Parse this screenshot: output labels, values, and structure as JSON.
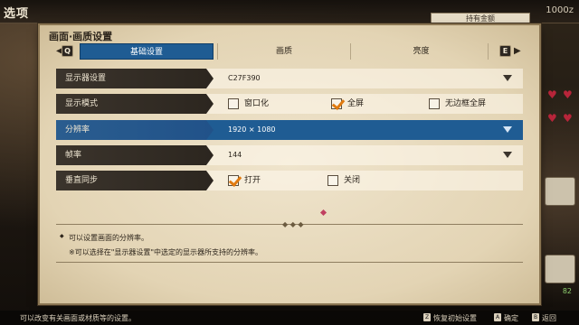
{
  "screen_title": "选项",
  "background": {
    "counter": "1000z",
    "tab_text": "持有金额"
  },
  "panel": {
    "title": "画面·画质设置",
    "tabs": {
      "left_key": "Q",
      "right_key": "E",
      "items": [
        {
          "label": "基础设置",
          "active": true
        },
        {
          "label": "画质",
          "active": false
        },
        {
          "label": "亮度",
          "active": false
        }
      ]
    },
    "rows": [
      {
        "label": "显示器设置",
        "type": "dropdown",
        "value": "C27F390"
      },
      {
        "label": "显示模式",
        "type": "radio",
        "options": [
          {
            "label": "窗口化",
            "checked": false
          },
          {
            "label": "全屏",
            "checked": true
          },
          {
            "label": "无边框全屏",
            "checked": false
          }
        ]
      },
      {
        "label": "分辨率",
        "type": "dropdown",
        "value": "1920 × 1080",
        "selected": true
      },
      {
        "label": "帧率",
        "type": "dropdown",
        "value": "144"
      },
      {
        "label": "垂直同步",
        "type": "radio",
        "options": [
          {
            "label": "打开",
            "checked": true
          },
          {
            "label": "关闭",
            "checked": false
          }
        ]
      }
    ],
    "description": {
      "line1": "可以设置画面的分辨率。",
      "line2": "※可以选择在\"显示器设置\"中选定的显示器所支持的分辨率。"
    }
  },
  "footer": {
    "hint": "可以改变有关画面或材质等的设置。",
    "controls": [
      {
        "key": "Z",
        "label": "恢复初始设置"
      },
      {
        "key": "A",
        "label": "确定"
      },
      {
        "key": "B",
        "label": "返回"
      }
    ]
  },
  "side_badge": "82",
  "colors": {
    "selected_row": "#1f5c93",
    "active_tab": "#1f5c93",
    "checkmark": "#e07a10",
    "parchment": "#e8dcc0"
  }
}
